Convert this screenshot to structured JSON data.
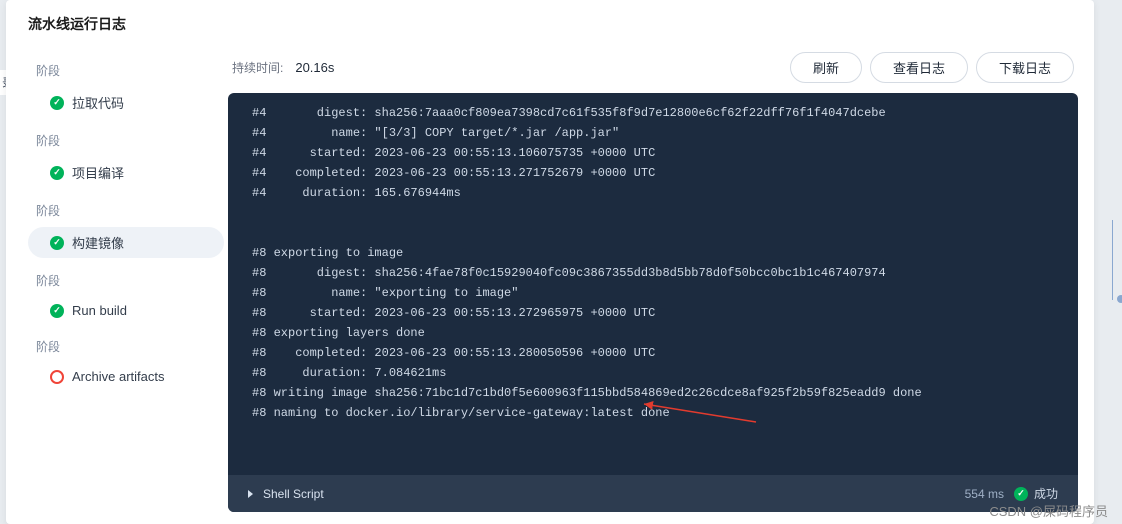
{
  "header": {
    "title": "流水线运行日志"
  },
  "sidebar": {
    "stage_label": "阶段",
    "stages": [
      {
        "label": "拉取代码",
        "status": "success",
        "active": false
      },
      {
        "label": "项目编译",
        "status": "success",
        "active": false
      },
      {
        "label": "构建镜像",
        "status": "success",
        "active": true
      },
      {
        "label": "Run build",
        "status": "success",
        "active": false
      },
      {
        "label": "Archive artifacts",
        "status": "pending",
        "active": false
      }
    ]
  },
  "toolbar": {
    "duration_label": "持续时间:",
    "duration_value": "20.16s",
    "refresh": "刷新",
    "view_log": "查看日志",
    "download_log": "下载日志"
  },
  "logs": [
    "#4       digest: sha256:7aaa0cf809ea7398cd7c61f535f8f9d7e12800e6cf62f22dff76f1f4047dcebe",
    "#4         name: \"[3/3] COPY target/*.jar /app.jar\"",
    "#4      started: 2023-06-23 00:55:13.106075735 +0000 UTC",
    "#4    completed: 2023-06-23 00:55:13.271752679 +0000 UTC",
    "#4     duration: 165.676944ms",
    "",
    "",
    "#8 exporting to image",
    "#8       digest: sha256:4fae78f0c15929040fc09c3867355dd3b8d5bb78d0f50bcc0bc1b1c467407974",
    "#8         name: \"exporting to image\"",
    "#8      started: 2023-06-23 00:55:13.272965975 +0000 UTC",
    "#8 exporting layers done",
    "#8    completed: 2023-06-23 00:55:13.280050596 +0000 UTC",
    "#8     duration: 7.084621ms",
    "#8 writing image sha256:71bc1d7c1bd0f5e600963f115bbd584869ed2c26cdce8af925f2b59f825eadd9 done",
    "#8 naming to docker.io/library/service-gateway:latest done"
  ],
  "log_footer": {
    "title": "Shell Script",
    "duration": "554 ms",
    "status": "成功"
  },
  "edge_tab": "录",
  "watermark": "CSDN @屎码程序员"
}
